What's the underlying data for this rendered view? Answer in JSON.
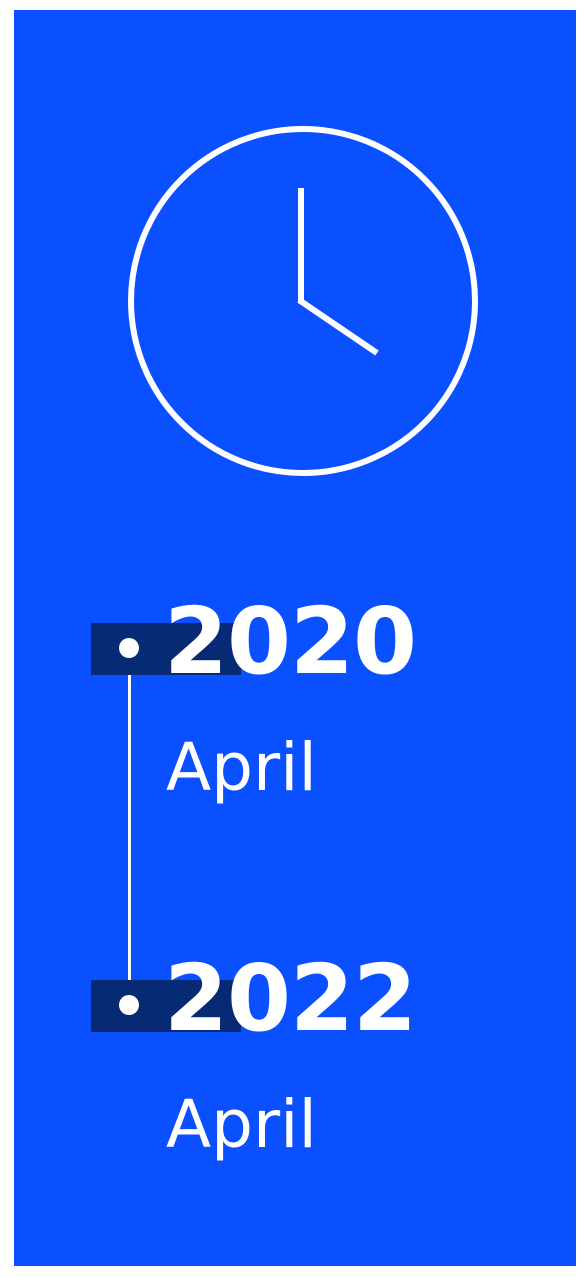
{
  "colors": {
    "background": "#0b50ff",
    "marker": "#062a73",
    "foreground": "#ffffff"
  },
  "icon": "clock-icon",
  "timeline": [
    {
      "year": "2020",
      "month": "April"
    },
    {
      "year": "2022",
      "month": "April"
    }
  ]
}
